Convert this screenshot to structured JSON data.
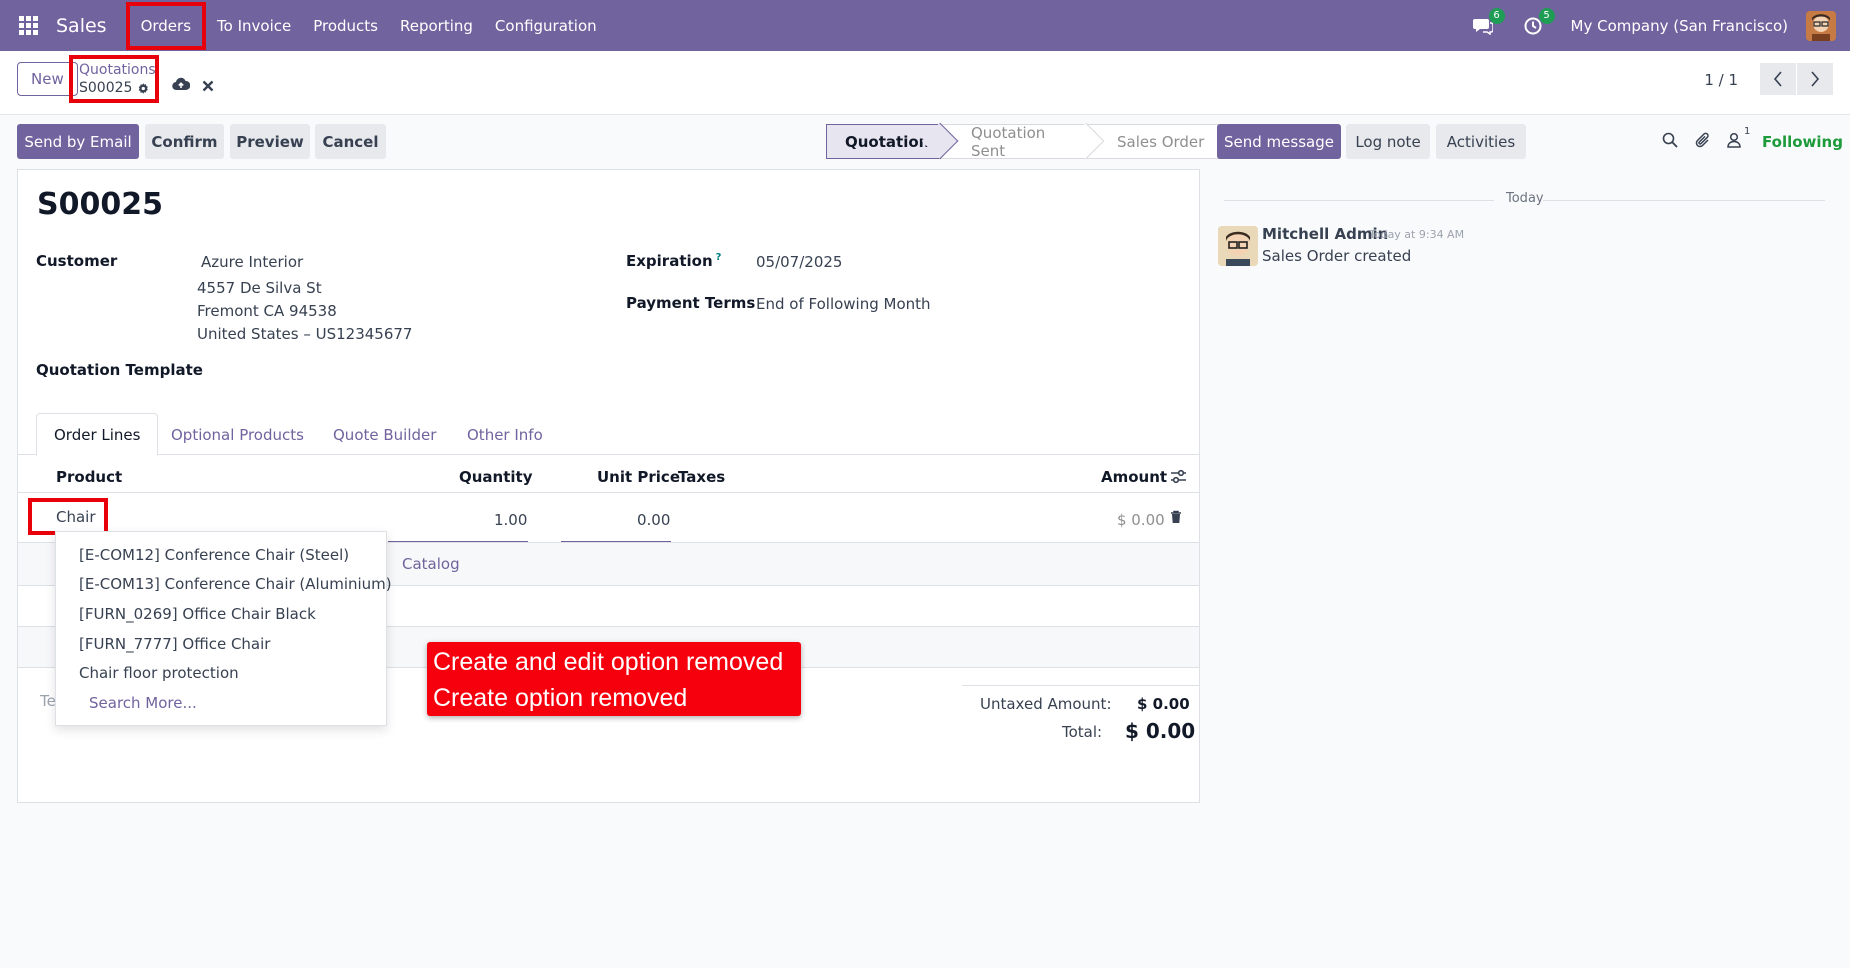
{
  "navbar": {
    "app_name": "Sales",
    "menu": [
      "Orders",
      "To Invoice",
      "Products",
      "Reporting",
      "Configuration"
    ],
    "messages_count": "6",
    "activities_count": "5",
    "company": "My Company (San Francisco)"
  },
  "control": {
    "new_label": "New",
    "breadcrumb_parent": "Quotations",
    "breadcrumb_current": "S00025",
    "pager": "1 / 1"
  },
  "actions": {
    "send_email": "Send by Email",
    "confirm": "Confirm",
    "preview": "Preview",
    "cancel": "Cancel"
  },
  "status_stages": [
    "Quotation",
    "Quotation Sent",
    "Sales Order"
  ],
  "record": {
    "name": "S00025",
    "customer_label": "Customer",
    "customer_name": "Azure Interior",
    "address_line1": "4557 De Silva St",
    "address_line2": "Fremont CA 94538",
    "address_line3": "United States – US12345677",
    "expiration_label": "Expiration",
    "expiration_help": "?",
    "expiration": "05/07/2025",
    "payment_terms_label": "Payment Terms",
    "payment_terms": "End of Following Month",
    "template_label": "Quotation Template"
  },
  "tabs": [
    "Order Lines",
    "Optional Products",
    "Quote Builder",
    "Other Info"
  ],
  "table": {
    "headers": {
      "product": "Product",
      "quantity": "Quantity",
      "unit_price": "Unit Price",
      "taxes": "Taxes",
      "amount": "Amount"
    },
    "line": {
      "product": "Chair",
      "quantity": "1.00",
      "unit_price": "0.00",
      "amount": "$ 0.00"
    },
    "catalog": "Catalog",
    "terms_partial": "Te"
  },
  "totals": {
    "untaxed_label": "Untaxed Amount:",
    "untaxed": "$ 0.00",
    "total_label": "Total:",
    "total": "$ 0.00"
  },
  "dropdown": {
    "items": [
      "[E-COM12] Conference Chair (Steel)",
      "[E-COM13] Conference Chair (Aluminium)",
      "[FURN_0269] Office Chair Black",
      "[FURN_7777] Office Chair",
      "Chair floor protection"
    ],
    "search_more": "Search More..."
  },
  "callout": {
    "line1": "Create and edit option removed",
    "line2": "Create option removed"
  },
  "chatter": {
    "send_message": "Send message",
    "log_note": "Log note",
    "activities": "Activities",
    "followers_count": "1",
    "following": "Following",
    "today": "Today",
    "author": "Mitchell Admin",
    "time": "Today at 9:34 AM",
    "body": "Sales Order created"
  },
  "colors": {
    "brand": "#71639e",
    "highlight": "#e8000b",
    "following": "#1d9a3a"
  }
}
